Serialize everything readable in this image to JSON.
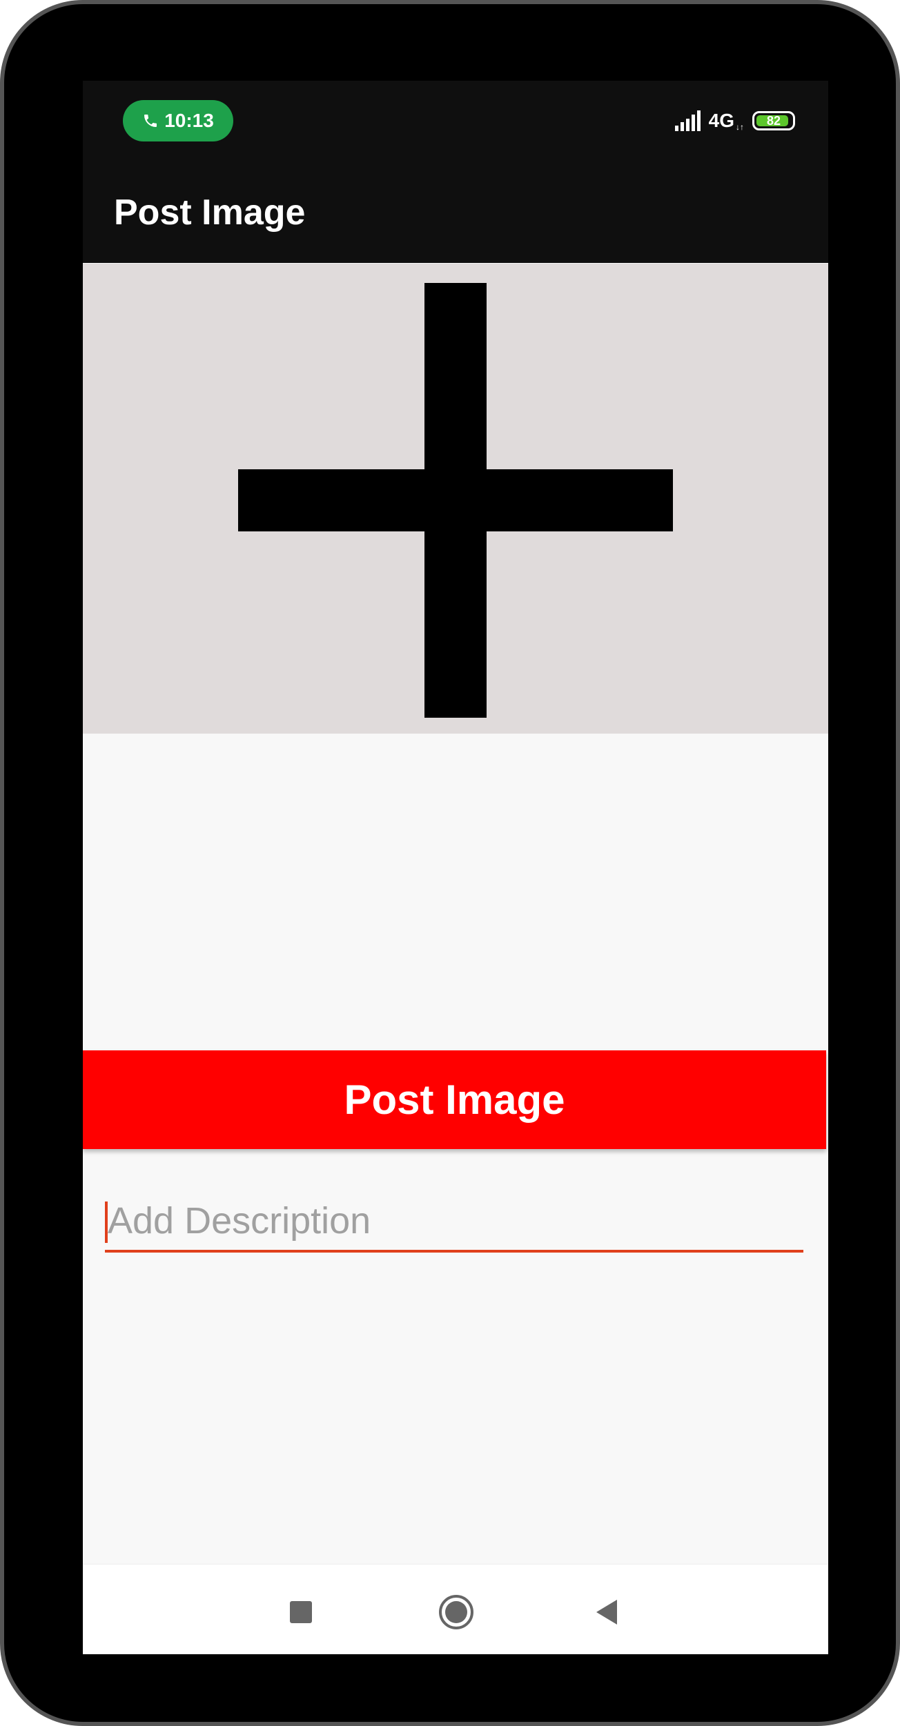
{
  "status_bar": {
    "call_time": "10:13",
    "network": "4G",
    "network_arrows": "↓↑",
    "battery_level": "82",
    "icons": [
      "phone-icon",
      "signal-icon",
      "battery-icon"
    ]
  },
  "app_bar": {
    "title": "Post Image"
  },
  "image_picker": {
    "icon": "plus-icon",
    "background_color": "#e0dbdb"
  },
  "post_button": {
    "label": "Post Image",
    "color": "#ff0000"
  },
  "description": {
    "value": "",
    "placeholder": "Add Description",
    "accent_color": "#e0401c"
  },
  "nav_bar": {
    "icons": [
      "recent-apps-icon",
      "home-icon",
      "back-icon"
    ]
  }
}
